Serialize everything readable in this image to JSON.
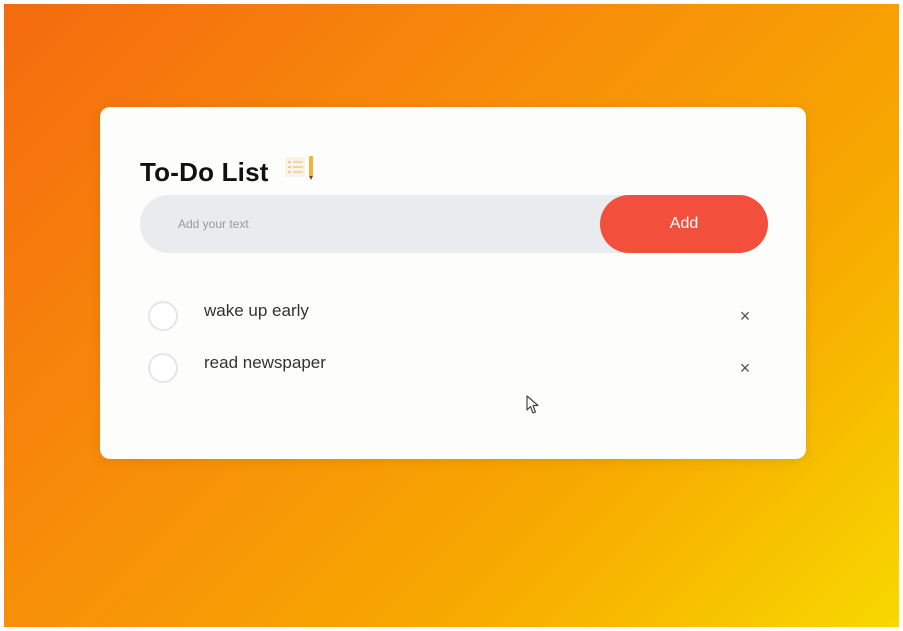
{
  "header": {
    "title": "To-Do List",
    "icon": "list-icon"
  },
  "input": {
    "value": "",
    "placeholder": "Add your text"
  },
  "actions": {
    "add_label": "Add"
  },
  "todos": [
    {
      "text": "wake up early",
      "checked": false,
      "remove_glyph": "×"
    },
    {
      "text": "read newspaper",
      "checked": false,
      "remove_glyph": "×"
    }
  ],
  "colors": {
    "accent": "#f2503c",
    "gradient_start": "#f56a0f",
    "gradient_end": "#f7d800",
    "input_bg": "#e9ebee",
    "card_bg": "#fdfdfb"
  }
}
